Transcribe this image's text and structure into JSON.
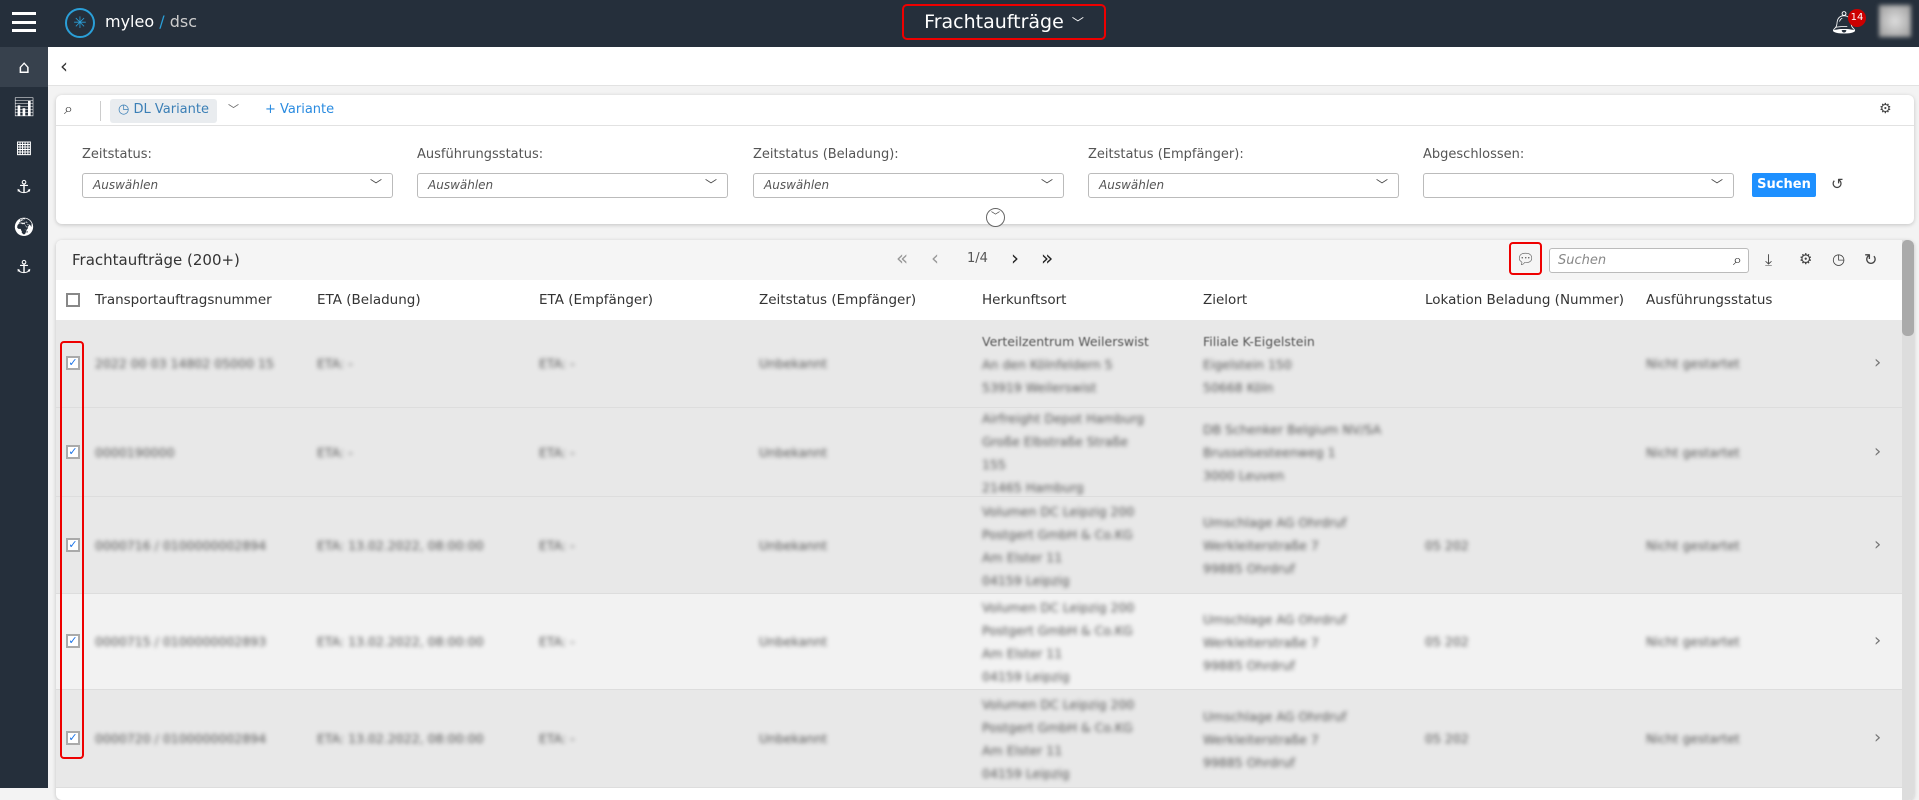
{
  "header": {
    "brand": "myleo",
    "brand_suffix": "dsc",
    "title": "Frachtaufträge",
    "notifications": "14"
  },
  "filters": {
    "variant": "DL Variante",
    "add_variant": "+ Variante",
    "fields": [
      {
        "label": "Zeitstatus:",
        "placeholder": "Auswählen"
      },
      {
        "label": "Ausführungsstatus:",
        "placeholder": "Auswählen"
      },
      {
        "label": "Zeitstatus (Beladung):",
        "placeholder": "Auswählen"
      },
      {
        "label": "Zeitstatus (Empfänger):",
        "placeholder": "Auswählen"
      },
      {
        "label": "Abgeschlossen:",
        "placeholder": ""
      }
    ],
    "search_button": "Suchen"
  },
  "table": {
    "title": "Frachtaufträge (200+)",
    "page": "1/4",
    "search_placeholder": "Suchen",
    "columns": [
      "Transportauftragsnummer",
      "ETA (Beladung)",
      "ETA (Empfänger)",
      "Zeitstatus (Empfänger)",
      "Herkunftsort",
      "Zielort",
      "Lokation Beladung (Nummer)",
      "Ausführungsstatus"
    ],
    "rows": [
      {
        "nr": "2022 00 03 14802 05000 15",
        "eta_bel": "ETA: -",
        "eta_emp": "ETA: -",
        "zeitstatus": "Unbekannt",
        "herkunft": [
          "Verteilzentrum Weilerswist",
          "An den Kölnfeldern 5",
          "53919 Weilerswist"
        ],
        "ziel": [
          "Filiale K-Eigelstein",
          "Eigelstein 150",
          "50668 Köln"
        ],
        "lokation": "",
        "status": "Nicht gestartet"
      },
      {
        "nr": "0000190000",
        "eta_bel": "ETA: -",
        "eta_emp": "ETA: -",
        "zeitstatus": "Unbekannt",
        "herkunft": [
          "Airfreight Depot Hamburg",
          "Große Elbstraße Straße",
          "155",
          "21465 Hamburg"
        ],
        "ziel": [
          "DB Schenker Belgium NV/SA",
          "Brusselsesteenweg 1",
          "3000 Leuven"
        ],
        "lokation": "",
        "status": "Nicht gestartet"
      },
      {
        "nr": "0000716 / 0100000002894",
        "eta_bel": "ETA: 13.02.2022, 08:00:00",
        "eta_emp": "ETA: -",
        "zeitstatus": "Unbekannt",
        "herkunft": [
          "Volumen DC Leipzig 200",
          "Postgert GmbH & Co.KG",
          "Am Elster 11",
          "04159 Leipzig"
        ],
        "ziel": [
          "Umschlage AG Ohrdruf",
          "Werkleiterstraße 7",
          "99885 Ohrdruf"
        ],
        "lokation": "05 202",
        "status": "Nicht gestartet"
      },
      {
        "nr": "0000715 / 0100000002893",
        "eta_bel": "ETA: 13.02.2022, 08:00:00",
        "eta_emp": "ETA: -",
        "zeitstatus": "Unbekannt",
        "herkunft": [
          "Volumen DC Leipzig 200",
          "Postgert GmbH & Co.KG",
          "Am Elster 11",
          "04159 Leipzig"
        ],
        "ziel": [
          "Umschlage AG Ohrdruf",
          "Werkleiterstraße 7",
          "99885 Ohrdruf"
        ],
        "lokation": "05 202",
        "status": "Nicht gestartet"
      },
      {
        "nr": "0000720 / 0100000002894",
        "eta_bel": "ETA: 13.02.2022, 08:00:00",
        "eta_emp": "ETA: -",
        "zeitstatus": "Unbekannt",
        "herkunft": [
          "Volumen DC Leipzig 200",
          "Postgert GmbH & Co.KG",
          "Am Elster 11",
          "04159 Leipzig"
        ],
        "ziel": [
          "Umschlage AG Ohrdruf",
          "Werkleiterstraße 7",
          "99885 Ohrdruf"
        ],
        "lokation": "05 202",
        "status": "Nicht gestartet"
      }
    ]
  }
}
